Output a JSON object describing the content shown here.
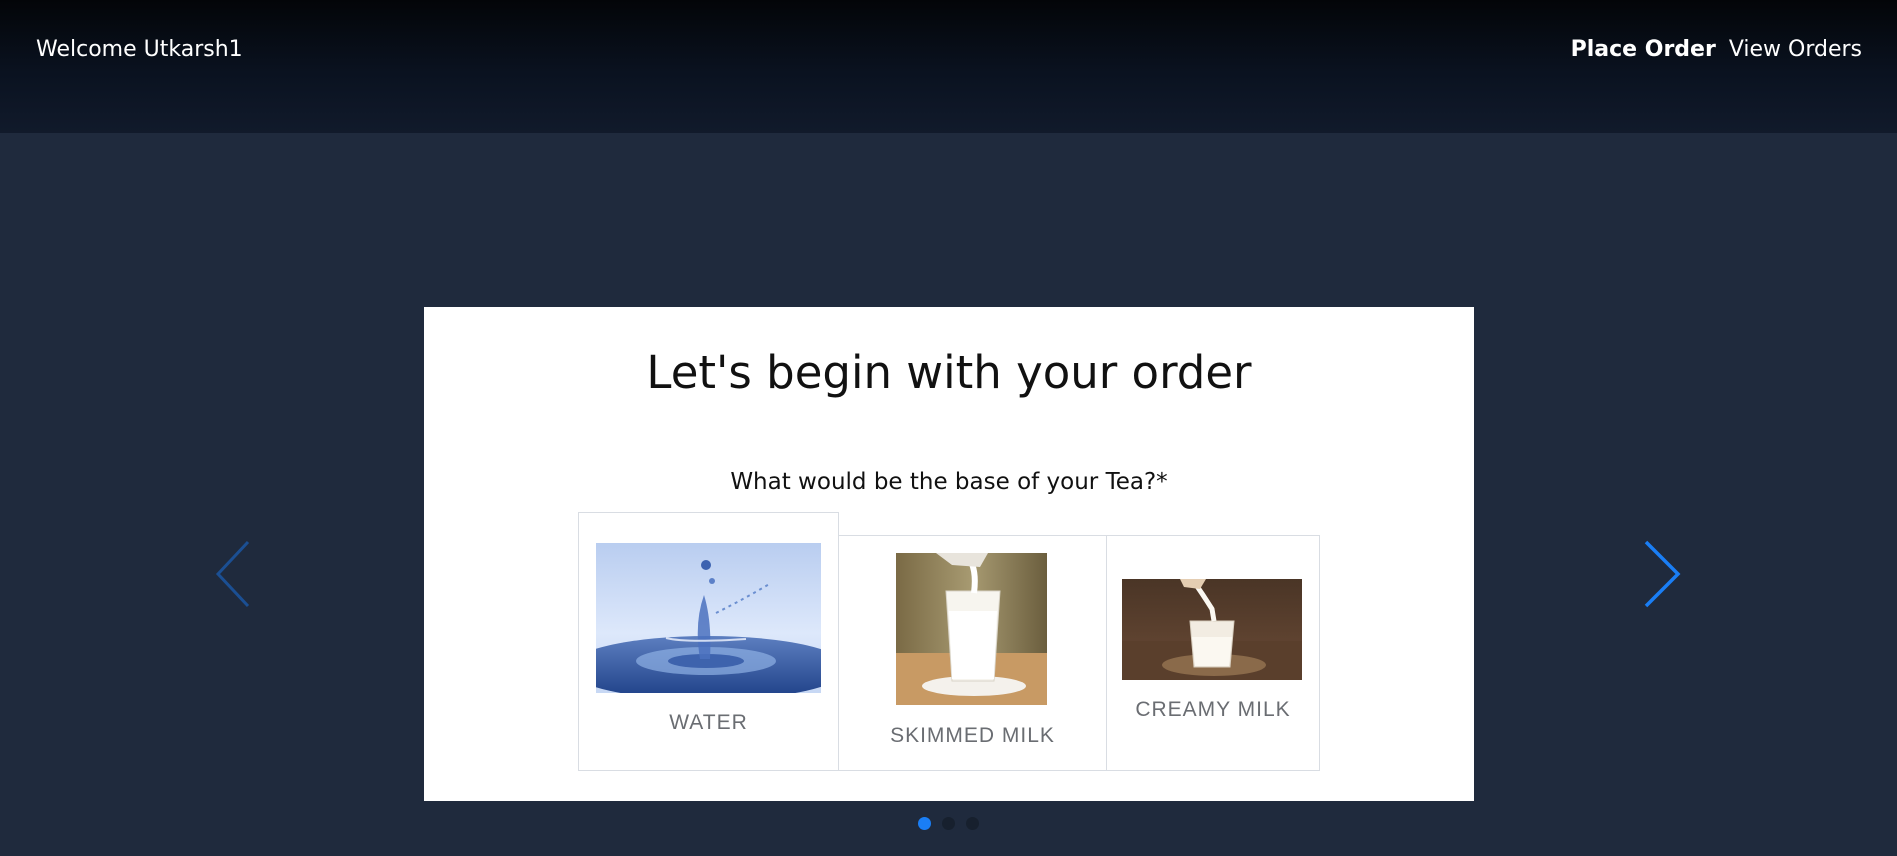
{
  "header": {
    "welcome_text": "Welcome Utkarsh1",
    "nav": [
      {
        "label": "Place Order",
        "active": true
      },
      {
        "label": "View Orders",
        "active": false
      }
    ]
  },
  "carousel": {
    "prev_icon": "chevron-left-icon",
    "next_icon": "chevron-right-icon",
    "indicator_count": 3,
    "active_index": 0,
    "accent_color": "#1a7ef5"
  },
  "order_card": {
    "title": "Let's begin with your order",
    "question": "What would be the base of your Tea?*",
    "options": [
      {
        "label": "WATER",
        "image": "water-splash-photo",
        "selected": true
      },
      {
        "label": "SKIMMED MILK",
        "image": "milk-pour-glass-photo",
        "selected": false
      },
      {
        "label": "CREAMY MILK",
        "image": "creamy-milk-glass-photo",
        "selected": false
      }
    ]
  }
}
